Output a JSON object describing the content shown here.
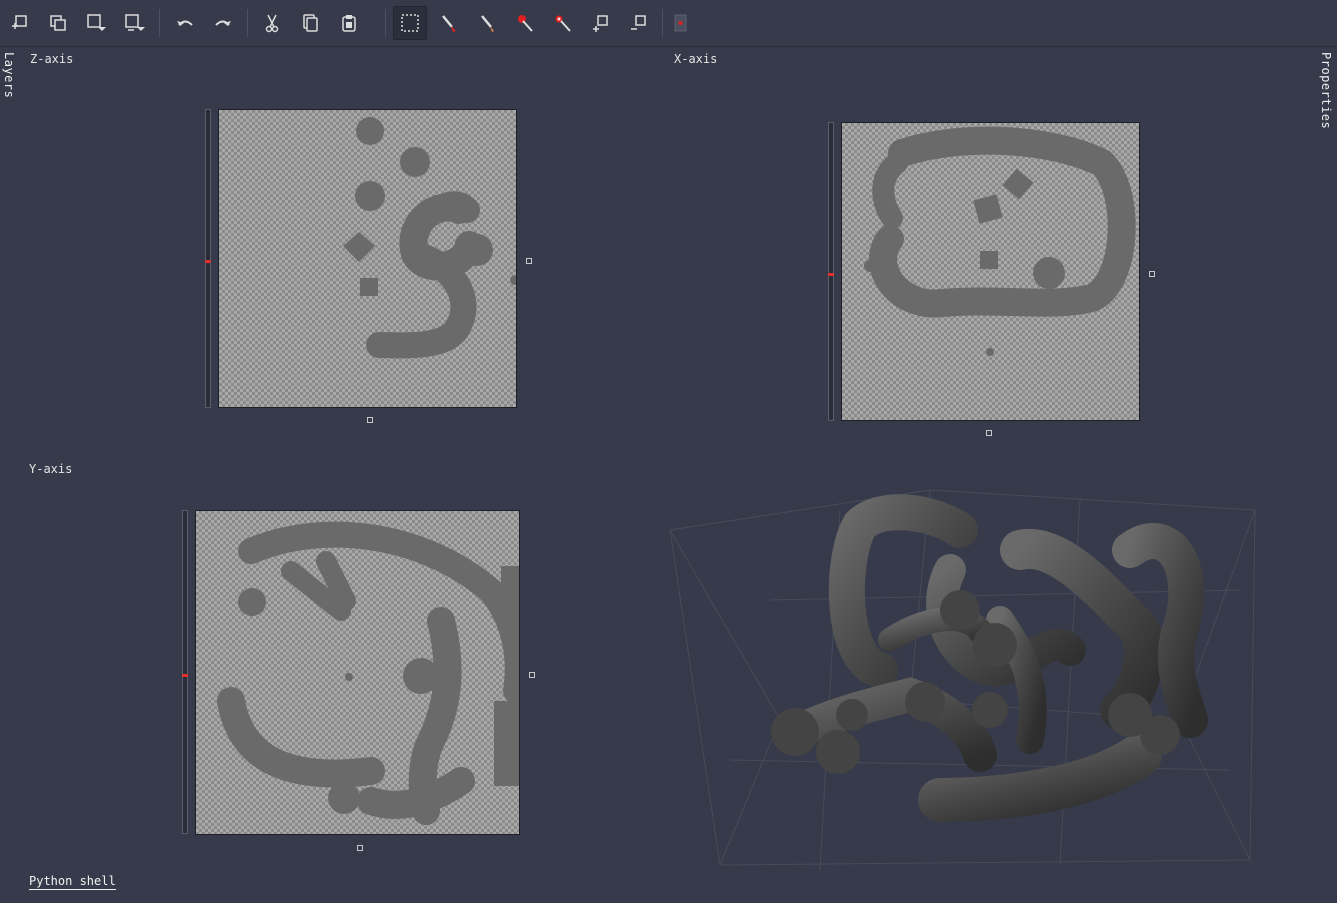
{
  "toolbar": {
    "buttons": [
      {
        "name": "new-layer-button",
        "icon": "new-layer-icon"
      },
      {
        "name": "duplicate-layer-button",
        "icon": "duplicate-icon"
      },
      {
        "name": "layer-down-button",
        "icon": "layer-down-icon"
      },
      {
        "name": "layer-merge-button",
        "icon": "layer-merge-icon"
      },
      {
        "name": "undo-button",
        "icon": "undo-icon"
      },
      {
        "name": "redo-button",
        "icon": "redo-icon"
      },
      {
        "name": "cut-button",
        "icon": "scissors-icon"
      },
      {
        "name": "copy-button",
        "icon": "copy-icon"
      },
      {
        "name": "paste-button",
        "icon": "paste-icon"
      },
      {
        "name": "select-rect-button",
        "icon": "selection-rect-icon",
        "active": true
      },
      {
        "name": "brush-red-button",
        "icon": "brush-icon"
      },
      {
        "name": "pen-button",
        "icon": "pen-icon"
      },
      {
        "name": "fill-red-button",
        "icon": "fill-icon"
      },
      {
        "name": "picker-button",
        "icon": "color-picker-icon"
      },
      {
        "name": "zoom-in-button",
        "icon": "zoom-in-icon"
      },
      {
        "name": "zoom-out-button",
        "icon": "zoom-out-icon"
      },
      {
        "name": "record-button",
        "icon": "record-icon"
      }
    ],
    "accent": "#e02020"
  },
  "side": {
    "left_tab": "Layers",
    "right_tab": "Properties"
  },
  "views": {
    "z_label": "Z-axis",
    "x_label": "X-axis",
    "y_label": "Y-axis"
  },
  "footer": {
    "python_shell": "Python shell"
  }
}
